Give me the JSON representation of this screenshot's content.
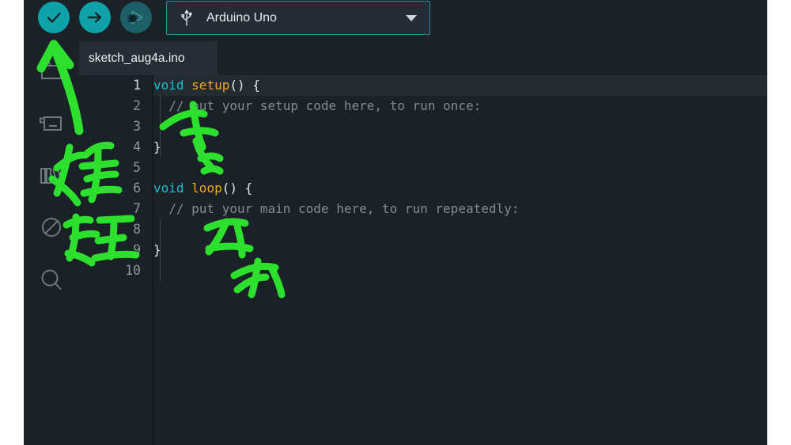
{
  "app": {
    "name": "Arduino IDE",
    "background_color": "#1a2127",
    "accent_color": "#0da3a8"
  },
  "toolbar": {
    "verify_button": {
      "label": "Verify",
      "icon": "check-icon"
    },
    "upload_button": {
      "label": "Upload",
      "icon": "arrow-right-icon"
    },
    "debug_button": {
      "label": "Debug",
      "icon": "debug-bug-play-icon",
      "enabled": false
    },
    "board_selector": {
      "icon": "usb-icon",
      "value": "Arduino Uno",
      "caret": "chevron-down-icon"
    }
  },
  "sidebar": {
    "items": [
      {
        "name": "sketchbook",
        "icon": "folder-icon"
      },
      {
        "name": "boards-manager",
        "icon": "board-chip-icon"
      },
      {
        "name": "library-manager",
        "icon": "books-icon"
      },
      {
        "name": "debug",
        "icon": "circle-slash-icon"
      },
      {
        "name": "search",
        "icon": "magnifier-icon"
      }
    ]
  },
  "tabs": [
    {
      "label": "sketch_aug4a.ino",
      "active": true
    }
  ],
  "editor": {
    "line_numbers": [
      "1",
      "2",
      "3",
      "4",
      "5",
      "6",
      "7",
      "8",
      "9",
      "10"
    ],
    "active_line": 1,
    "lines": [
      {
        "n": 1,
        "segments": [
          {
            "text": "void",
            "cls": "kw"
          },
          {
            "text": " ",
            "cls": "punc"
          },
          {
            "text": "setup",
            "cls": "fn"
          },
          {
            "text": "() {",
            "cls": "punc"
          }
        ]
      },
      {
        "n": 2,
        "segments": [
          {
            "text": "  // put your setup code here, to run once:",
            "cls": "cmt"
          }
        ]
      },
      {
        "n": 3,
        "segments": [
          {
            "text": "",
            "cls": "punc"
          }
        ]
      },
      {
        "n": 4,
        "segments": [
          {
            "text": "}",
            "cls": "punc"
          }
        ]
      },
      {
        "n": 5,
        "segments": [
          {
            "text": "",
            "cls": "punc"
          }
        ]
      },
      {
        "n": 6,
        "segments": [
          {
            "text": "void",
            "cls": "kw"
          },
          {
            "text": " ",
            "cls": "punc"
          },
          {
            "text": "loop",
            "cls": "fn"
          },
          {
            "text": "() {",
            "cls": "punc"
          }
        ]
      },
      {
        "n": 7,
        "segments": [
          {
            "text": "  // put your main code here, to run repeatedly:",
            "cls": "cmt"
          }
        ]
      },
      {
        "n": 8,
        "segments": [
          {
            "text": "",
            "cls": "punc"
          }
        ]
      },
      {
        "n": 9,
        "segments": [
          {
            "text": "}",
            "cls": "punc"
          }
        ]
      },
      {
        "n": 10,
        "segments": [
          {
            "text": "",
            "cls": "punc"
          }
        ]
      }
    ]
  },
  "annotations": {
    "ink_color": "#2ee02e",
    "marks": [
      {
        "name": "arrow-to-verify-button",
        "kind": "arrow"
      },
      {
        "name": "handwritten-kanji-kenshou",
        "text": "検証"
      },
      {
        "name": "handwritten-scribble-upper",
        "text": "コン"
      },
      {
        "name": "handwritten-scribble-lower",
        "text": "パイル"
      }
    ]
  }
}
